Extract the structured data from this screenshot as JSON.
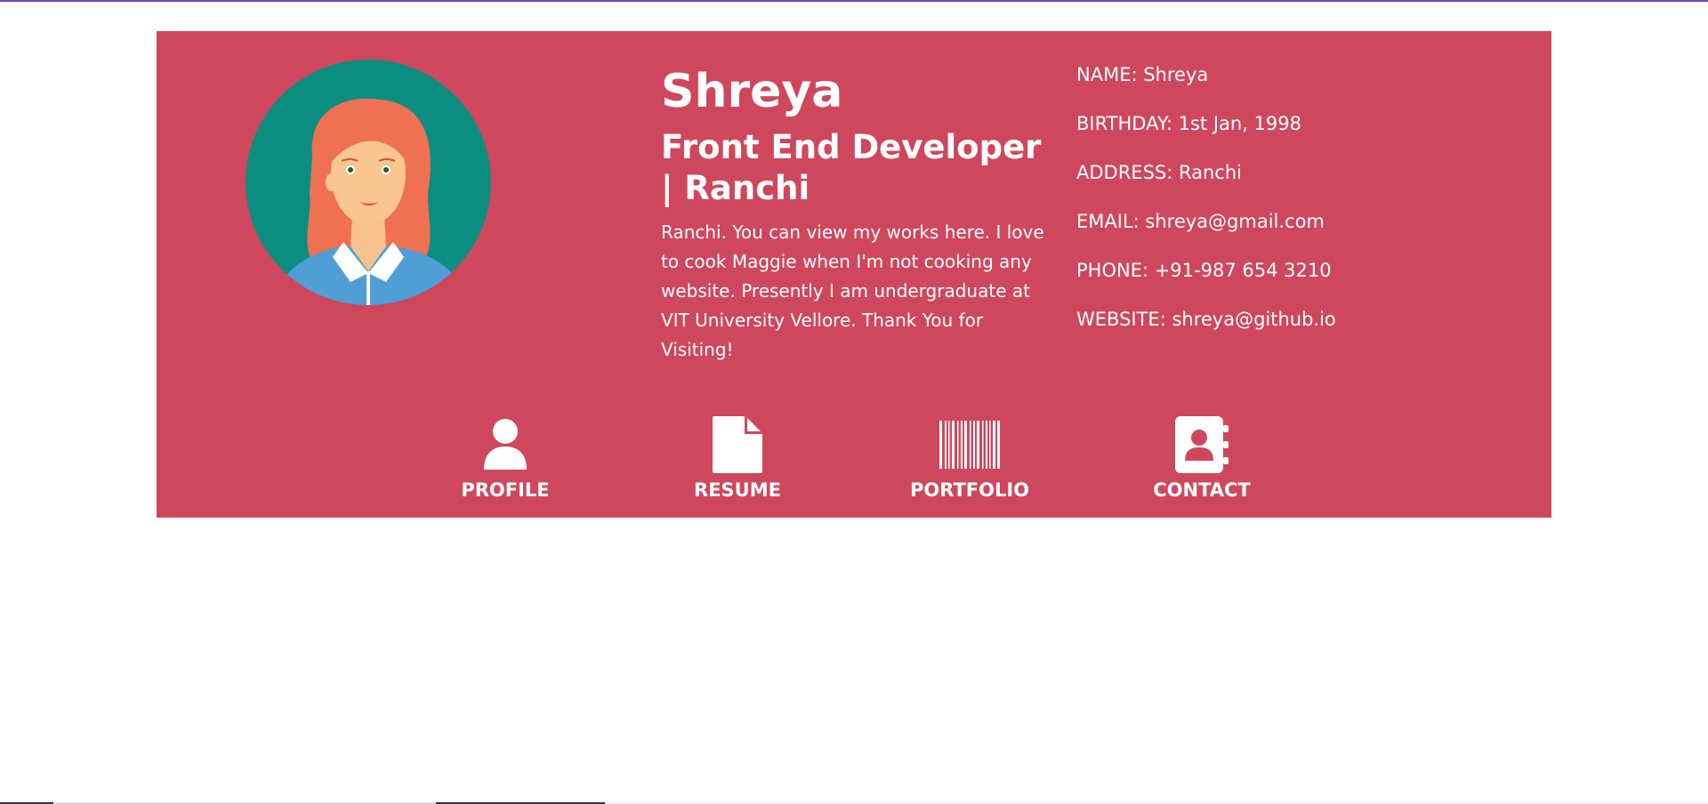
{
  "profile": {
    "name": "Shreya",
    "role": "Front End Developer | Ranchi",
    "bio": "Ranchi. You can view my works here. I love to cook Maggie when I'm not cooking any website. Presently I am undergraduate at VIT University Vellore. Thank You for Visiting!"
  },
  "info": [
    "NAME: Shreya",
    "BIRTHDAY: 1st Jan, 1998",
    "ADDRESS: Ranchi",
    "EMAIL: shreya@gmail.com",
    "PHONE: +91-987 654 3210",
    "WEBSITE: shreya@github.io"
  ],
  "nav": [
    {
      "label": "PROFILE",
      "icon": "user-icon"
    },
    {
      "label": "RESUME",
      "icon": "document-icon"
    },
    {
      "label": "PORTFOLIO",
      "icon": "barcode-icon"
    },
    {
      "label": "CONTACT",
      "icon": "address-book-icon"
    }
  ],
  "colors": {
    "card_bg": "#cf475d",
    "avatar_bg": "#0b8e80",
    "text": "#ffffff"
  }
}
